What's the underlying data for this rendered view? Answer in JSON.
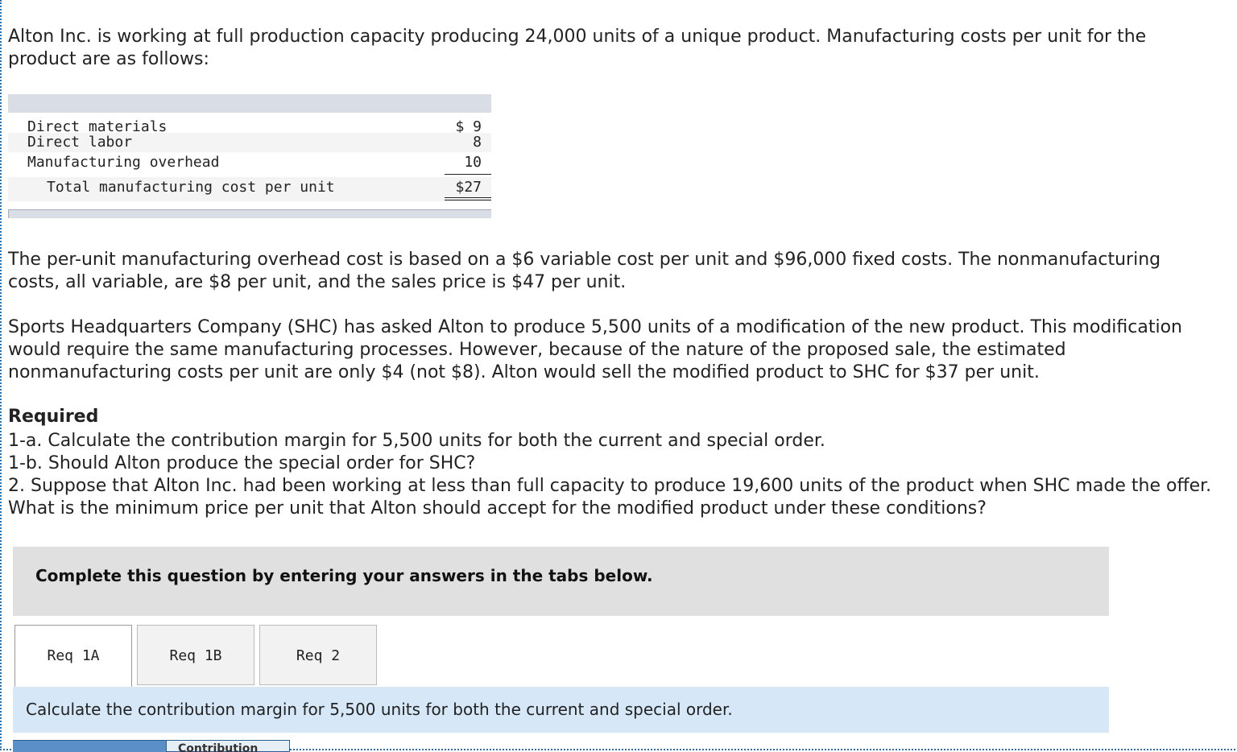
{
  "intro": "Alton Inc. is working at full production capacity producing 24,000 units of a unique product. Manufacturing costs per unit for the product are as follows:",
  "cost_table": {
    "rows": [
      {
        "label": "Direct materials",
        "value": "$ 9"
      },
      {
        "label": "Direct labor",
        "value": "8"
      },
      {
        "label": "Manufacturing overhead",
        "value": "10"
      }
    ],
    "total": {
      "label": "Total manufacturing cost per unit",
      "value": "$27"
    }
  },
  "para2": "The per-unit manufacturing overhead cost is based on a $6 variable cost per unit and $96,000 fixed costs. The nonmanufacturing costs, all variable, are $8 per unit, and the sales price is $47 per unit.",
  "para3": "Sports Headquarters Company (SHC) has asked Alton to produce 5,500 units of a modification of the new product. This modification would require the same manufacturing processes. However, because of the nature of the proposed sale, the estimated nonmanufacturing costs per unit are only $4 (not $8). Alton would sell the modified product to SHC for $37 per unit.",
  "required": {
    "title": "Required",
    "items": [
      "1-a. Calculate the contribution margin for 5,500 units for both the current and special order.",
      "1-b. Should Alton produce the special order for SHC?",
      "2. Suppose that Alton Inc. had been working at less than full capacity to produce 19,600 units of the product when SHC made the offer. What is the minimum price per unit that Alton should accept for the modified product under these conditions?"
    ]
  },
  "banner": "Complete this question by entering your answers in the tabs below.",
  "tabs": [
    {
      "label": "Req 1A",
      "active": true
    },
    {
      "label": "Req 1B",
      "active": false
    },
    {
      "label": "Req 2",
      "active": false
    }
  ],
  "instruction": "Calculate the contribution margin for 5,500 units for both the current and special order.",
  "answer_header": "Contribution"
}
